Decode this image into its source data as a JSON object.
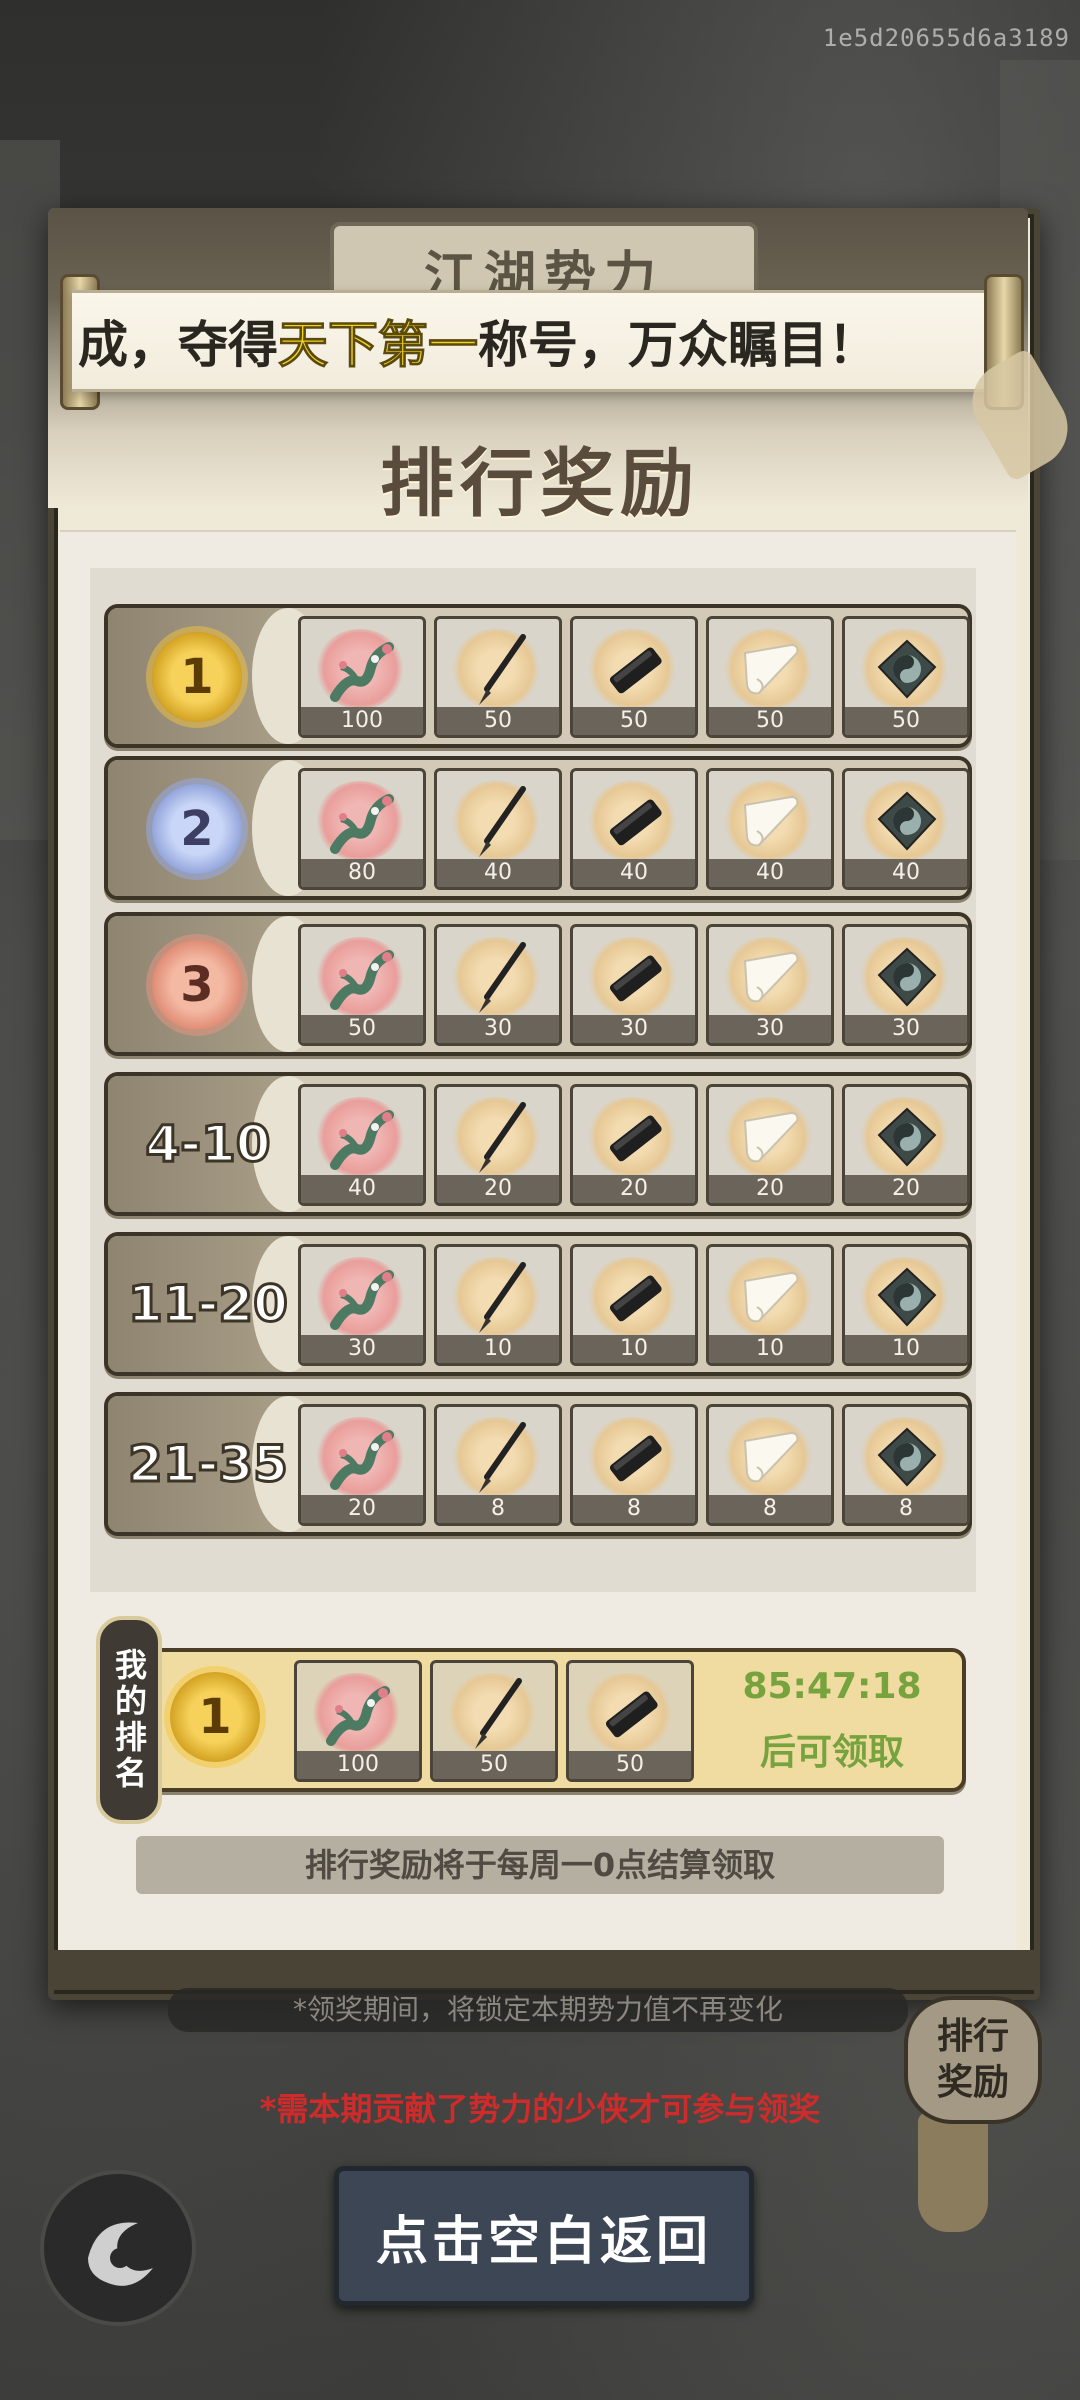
{
  "watermark": "1e5d20655d6a3189",
  "header": {
    "plaque": "江湖势力",
    "banner_pre": "成，夺得",
    "banner_hl": "天下第一",
    "banner_post": "称号，万众瞩目！",
    "section_title": "排行奖励"
  },
  "rows": [
    {
      "rank": "1",
      "counts": [
        "100",
        "50",
        "50",
        "50",
        "50"
      ]
    },
    {
      "rank": "2",
      "counts": [
        "80",
        "40",
        "40",
        "40",
        "40"
      ]
    },
    {
      "rank": "3",
      "counts": [
        "50",
        "30",
        "30",
        "30",
        "30"
      ]
    },
    {
      "rank": "4-10",
      "counts": [
        "40",
        "20",
        "20",
        "20",
        "20"
      ]
    },
    {
      "rank": "11-20",
      "counts": [
        "30",
        "10",
        "10",
        "10",
        "10"
      ]
    },
    {
      "rank": "21-35",
      "counts": [
        "20",
        "8",
        "8",
        "8",
        "8"
      ]
    }
  ],
  "item_icons": [
    "plum-branch-icon",
    "brush-icon",
    "ink-stick-icon",
    "paper-scroll-icon",
    "inkstone-icon"
  ],
  "my_rank": {
    "tag": "我的排名",
    "rank": "1",
    "counts": [
      "100",
      "50",
      "50"
    ],
    "timer": "85:47:18",
    "timer_label": "后可领取"
  },
  "notice": "排行奖励将于每周一0点结算领取",
  "lock_note": "*领奖期间，将锁定本期势力值不再变化",
  "warn_note": "*需本期贡献了势力的少侠才可参与领奖",
  "side_tag": {
    "line1": "排行",
    "line2": "奖励"
  },
  "back_button": "点击空白返回",
  "colors": {
    "gold": "#f6d25a",
    "silver": "#94a6dc",
    "bronze": "#e08d76",
    "timer": "#76a33e",
    "warn": "#cf2b2b"
  }
}
